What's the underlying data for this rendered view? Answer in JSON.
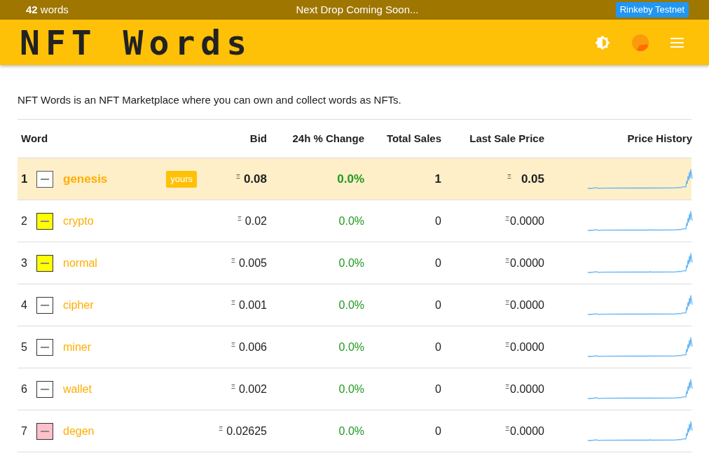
{
  "top_bar": {
    "word_count": "**42** words",
    "notice": "Next Drop Coming Soon...",
    "network_button": "Rinkeby Testnet"
  },
  "header": {
    "logo": "NFT Words"
  },
  "intro": "NFT Words is an NFT Marketplace where you can own and collect words as NFTs.",
  "table": {
    "columns": [
      "Word",
      "Bid",
      "24h % Change",
      "Total Sales",
      "Last Sale Price",
      "Price History"
    ],
    "rows": [
      {
        "rank": "1",
        "word": "genesis",
        "owned": true,
        "badge": "yours",
        "color": "#ffffff",
        "bid_symbol": "Ξ",
        "bid": "0.08",
        "change": "0.0%",
        "total_sales": "1",
        "last_sale_symbol": "Ξ",
        "last_sale_price": "0.05"
      },
      {
        "rank": "2",
        "word": "crypto",
        "owned": false,
        "color": "#ffff00",
        "bid_symbol": "Ξ",
        "bid": "0.02",
        "change": "0.0%",
        "total_sales": "0",
        "last_sale_symbol": "Ξ",
        "last_sale_price": "0.0000"
      },
      {
        "rank": "3",
        "word": "normal",
        "owned": false,
        "color": "#ffff00",
        "bid_symbol": "Ξ",
        "bid": "0.005",
        "change": "0.0%",
        "total_sales": "0",
        "last_sale_symbol": "Ξ",
        "last_sale_price": "0.0000"
      },
      {
        "rank": "4",
        "word": "cipher",
        "owned": false,
        "color": "#ffffff",
        "bid_symbol": "Ξ",
        "bid": "0.001",
        "change": "0.0%",
        "total_sales": "0",
        "last_sale_symbol": "Ξ",
        "last_sale_price": "0.0000"
      },
      {
        "rank": "5",
        "word": "miner",
        "owned": false,
        "color": "#ffffff",
        "bid_symbol": "Ξ",
        "bid": "0.006",
        "change": "0.0%",
        "total_sales": "0",
        "last_sale_symbol": "Ξ",
        "last_sale_price": "0.0000"
      },
      {
        "rank": "6",
        "word": "wallet",
        "owned": false,
        "color": "#ffffff",
        "bid_symbol": "Ξ",
        "bid": "0.002",
        "change": "0.0%",
        "total_sales": "0",
        "last_sale_symbol": "Ξ",
        "last_sale_price": "0.0000"
      },
      {
        "rank": "7",
        "word": "degen",
        "owned": false,
        "color": "#ffc0cb",
        "bid_symbol": "Ξ",
        "bid": "0.02625",
        "change": "0.0%",
        "total_sales": "0",
        "last_sale_symbol": "Ξ",
        "last_sale_price": "0.0000"
      }
    ]
  }
}
